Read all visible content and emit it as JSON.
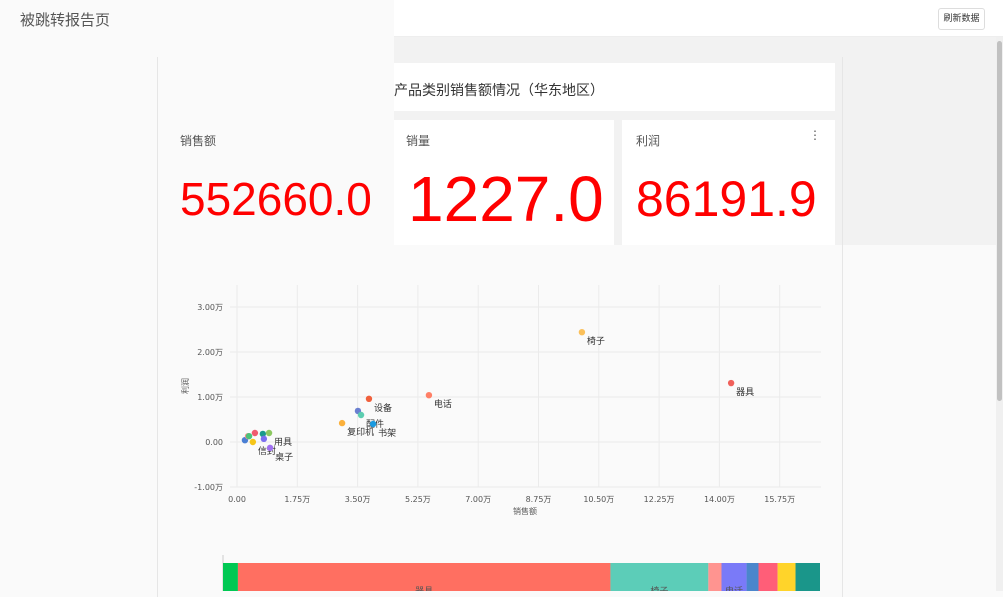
{
  "header": {
    "title": "被跳转报告页",
    "refresh_label": "刷新数据"
  },
  "report": {
    "title": "产品类别销售额情况（华东地区）"
  },
  "kpis": [
    {
      "label": "销售额",
      "value": "552660.0"
    },
    {
      "label": "销量",
      "value": "1227.0"
    },
    {
      "label": "利润",
      "value": "86191.9"
    }
  ],
  "chart_data": {
    "type": "scatter",
    "xlabel": "销售额",
    "ylabel": "利润",
    "xlim": [
      0,
      165000
    ],
    "ylim": [
      -10000,
      30000
    ],
    "x_ticks": [
      "0.00",
      "1.75万",
      "3.50万",
      "5.25万",
      "7.00万",
      "8.75万",
      "10.50万",
      "12.25万",
      "14.00万",
      "15.75万"
    ],
    "y_ticks": [
      "-1.00万",
      "0.00",
      "1.00万",
      "2.00万",
      "3.00万"
    ],
    "points": [
      {
        "label": "",
        "x": 2300,
        "y": 400,
        "color": "#4a7fd4"
      },
      {
        "label": "",
        "x": 3200,
        "y": 1300,
        "color": "#f59090"
      },
      {
        "label": "",
        "x": 3500,
        "y": 1300,
        "color": "#4cc27a"
      },
      {
        "label": "",
        "x": 5200,
        "y": 2000,
        "color": "#f05a6e"
      },
      {
        "label": "信封",
        "x": 4600,
        "y": 0,
        "color": "#f5c518"
      },
      {
        "label": "",
        "x": 7500,
        "y": 1800,
        "color": "#1a9a8a"
      },
      {
        "label": "",
        "x": 7800,
        "y": 700,
        "color": "#7a6ef0"
      },
      {
        "label": "用具",
        "x": 9300,
        "y": 2000,
        "color": "#8cc860"
      },
      {
        "label": "桌子",
        "x": 9600,
        "y": -1300,
        "color": "#a070f0"
      },
      {
        "label": "复印机",
        "x": 30500,
        "y": 4200,
        "color": "#fbb03b"
      },
      {
        "label": "",
        "x": 35100,
        "y": 6900,
        "color": "#6a7fd0"
      },
      {
        "label": "配件",
        "x": 36000,
        "y": 6000,
        "color": "#5ccdb0"
      },
      {
        "label": "设备",
        "x": 38300,
        "y": 9600,
        "color": "#f0603c"
      },
      {
        "label": "书架",
        "x": 39500,
        "y": 4000,
        "color": "#1a9ae0"
      },
      {
        "label": "电话",
        "x": 55700,
        "y": 10400,
        "color": "#ff7f66"
      },
      {
        "label": "椅子",
        "x": 100100,
        "y": 24400,
        "color": "#fbc05a"
      },
      {
        "label": "器具",
        "x": 143400,
        "y": 13100,
        "color": "#f0605a"
      }
    ]
  },
  "bar_segments": [
    {
      "label": "",
      "color": "#00c853",
      "share": 2.5
    },
    {
      "label": "器具",
      "color": "#ff6f61",
      "share": 62.4
    },
    {
      "label": "椅子",
      "color": "#5ccdb8",
      "share": 16.4
    },
    {
      "label": "",
      "color": "#ff9490",
      "share": 2.2
    },
    {
      "label": "电话",
      "color": "#7a7af8",
      "share": 4.2
    },
    {
      "label": "",
      "color": "#4a86cc",
      "share": 2.0
    },
    {
      "label": "",
      "color": "#ff5e78",
      "share": 3.2
    },
    {
      "label": "",
      "color": "#ffd42a",
      "share": 3.0
    },
    {
      "label": "",
      "color": "#1a968a",
      "share": 4.1
    }
  ]
}
